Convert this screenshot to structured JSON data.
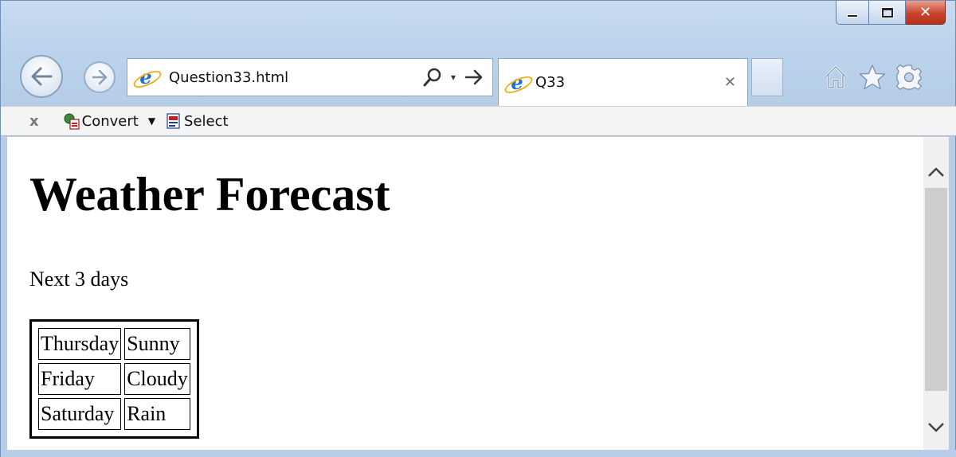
{
  "window": {
    "buttons": {
      "minimize": "minimize",
      "maximize": "maximize",
      "close": "✕"
    }
  },
  "nav": {
    "address": "Question33.html",
    "dropdown_glyph": "▾",
    "tab_title": "Q33",
    "tab_close": "✕"
  },
  "icons": {
    "back": "back-arrow-icon",
    "forward": "forward-arrow-icon",
    "search": "search-icon",
    "go": "go-arrow-icon",
    "home": "home-icon",
    "favorites": "star-icon",
    "tools": "gear-icon"
  },
  "command_bar": {
    "close_glyph": "x",
    "convert_label": "Convert",
    "caret": "▼",
    "select_label": "Select"
  },
  "page": {
    "title": "Weather Forecast",
    "subtitle": "Next 3 days",
    "rows": [
      {
        "day": "Thursday",
        "weather": "Sunny"
      },
      {
        "day": "Friday",
        "weather": "Cloudy"
      },
      {
        "day": "Saturday",
        "weather": "Rain"
      }
    ]
  },
  "colors": {
    "frame": "#bcd3ec",
    "close_button": "#c8432c",
    "ie_blue": "#1a6dd6"
  }
}
